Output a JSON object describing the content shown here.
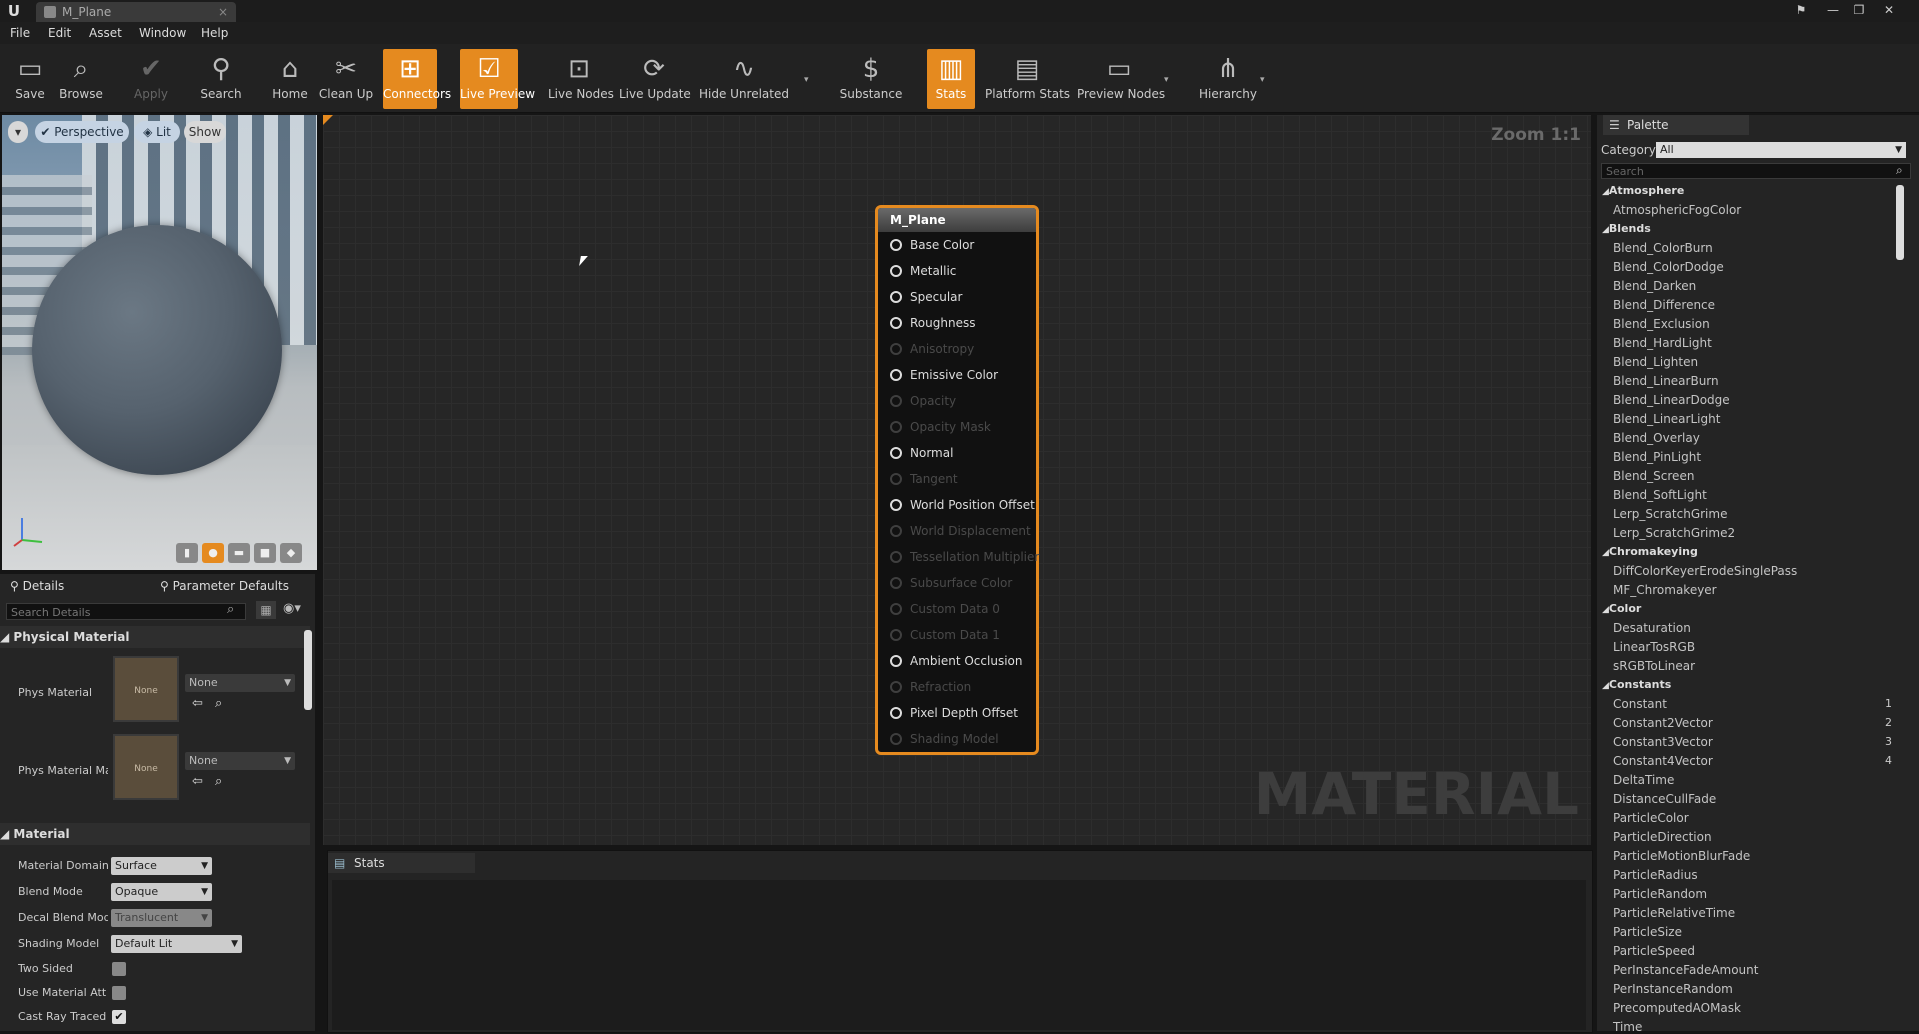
{
  "titlebar": {
    "tab_title": "M_Plane",
    "logo": "U"
  },
  "menu": [
    "File",
    "Edit",
    "Asset",
    "Window",
    "Help"
  ],
  "toolbar": [
    {
      "label": "Save",
      "icon": "save-icon",
      "glyph": "▭",
      "state": "normal"
    },
    {
      "label": "Browse",
      "icon": "browse-icon",
      "glyph": "⌕",
      "state": "normal"
    },
    {
      "label": "Apply",
      "icon": "apply-icon",
      "glyph": "✔",
      "state": "disabled"
    },
    {
      "label": "Search",
      "icon": "search-icon",
      "glyph": "⚲",
      "state": "normal"
    },
    {
      "label": "Home",
      "icon": "home-icon",
      "glyph": "⌂",
      "state": "normal"
    },
    {
      "label": "Clean Up",
      "icon": "cleanup-icon",
      "glyph": "✂",
      "state": "normal"
    },
    {
      "label": "Connectors",
      "icon": "connectors-icon",
      "glyph": "⊞",
      "state": "active"
    },
    {
      "label": "Live Preview",
      "icon": "live-preview-icon",
      "glyph": "☑",
      "state": "active"
    },
    {
      "label": "Live Nodes",
      "icon": "live-nodes-icon",
      "glyph": "⊡",
      "state": "normal"
    },
    {
      "label": "Live Update",
      "icon": "live-update-icon",
      "glyph": "⟳",
      "state": "normal"
    },
    {
      "label": "Hide Unrelated",
      "icon": "hide-unrelated-icon",
      "glyph": "∿",
      "state": "normal"
    },
    {
      "label": "Substance",
      "icon": "substance-icon",
      "glyph": "$",
      "state": "normal"
    },
    {
      "label": "Stats",
      "icon": "stats-icon",
      "glyph": "▥",
      "state": "active"
    },
    {
      "label": "Platform Stats",
      "icon": "platform-stats-icon",
      "glyph": "▤",
      "state": "normal"
    },
    {
      "label": "Preview Nodes",
      "icon": "preview-nodes-icon",
      "glyph": "▭",
      "state": "normal"
    },
    {
      "label": "Hierarchy",
      "icon": "hierarchy-icon",
      "glyph": "⋔",
      "state": "normal"
    }
  ],
  "viewport": {
    "perspective": "Perspective",
    "lit": "Lit",
    "show": "Show"
  },
  "details": {
    "tab_details": "Details",
    "tab_params": "Parameter Defaults",
    "search_placeholder": "Search Details",
    "physical_section": "Physical Material",
    "phys_material_label": "Phys Material",
    "phys_material_thumb": "None",
    "phys_material_value": "None",
    "phys_mask_label": "Phys Material Ma",
    "phys_mask_thumb": "None",
    "phys_mask_value": "None",
    "material_section": "Material",
    "domain_label": "Material Domain",
    "domain_value": "Surface",
    "blend_label": "Blend Mode",
    "blend_value": "Opaque",
    "decal_label": "Decal Blend Mode",
    "decal_value": "Translucent",
    "shading_label": "Shading Model",
    "shading_value": "Default Lit",
    "two_sided_label": "Two Sided",
    "use_material_label": "Use Material Attri",
    "cast_ray_label": "Cast Ray Traced S"
  },
  "graph": {
    "zoom": "Zoom 1:1",
    "watermark": "MATERIAL"
  },
  "node": {
    "title": "M_Plane",
    "pins": [
      {
        "label": "Base Color",
        "enabled": true
      },
      {
        "label": "Metallic",
        "enabled": true
      },
      {
        "label": "Specular",
        "enabled": true
      },
      {
        "label": "Roughness",
        "enabled": true
      },
      {
        "label": "Anisotropy",
        "enabled": false
      },
      {
        "label": "Emissive Color",
        "enabled": true
      },
      {
        "label": "Opacity",
        "enabled": false
      },
      {
        "label": "Opacity Mask",
        "enabled": false
      },
      {
        "label": "Normal",
        "enabled": true
      },
      {
        "label": "Tangent",
        "enabled": false
      },
      {
        "label": "World Position Offset",
        "enabled": true
      },
      {
        "label": "World Displacement",
        "enabled": false
      },
      {
        "label": "Tessellation Multiplier",
        "enabled": false
      },
      {
        "label": "Subsurface Color",
        "enabled": false
      },
      {
        "label": "Custom Data 0",
        "enabled": false
      },
      {
        "label": "Custom Data 1",
        "enabled": false
      },
      {
        "label": "Ambient Occlusion",
        "enabled": true
      },
      {
        "label": "Refraction",
        "enabled": false
      },
      {
        "label": "Pixel Depth Offset",
        "enabled": true
      },
      {
        "label": "Shading Model",
        "enabled": false
      }
    ]
  },
  "stats": {
    "tab": "Stats"
  },
  "palette": {
    "tab": "Palette",
    "category_label": "Category:",
    "category_value": "All",
    "search_placeholder": "Search",
    "rows": [
      {
        "type": "cat",
        "text": "Atmosphere"
      },
      {
        "type": "item",
        "text": "AtmosphericFogColor"
      },
      {
        "type": "cat",
        "text": "Blends"
      },
      {
        "type": "item",
        "text": "Blend_ColorBurn"
      },
      {
        "type": "item",
        "text": "Blend_ColorDodge"
      },
      {
        "type": "item",
        "text": "Blend_Darken"
      },
      {
        "type": "item",
        "text": "Blend_Difference"
      },
      {
        "type": "item",
        "text": "Blend_Exclusion"
      },
      {
        "type": "item",
        "text": "Blend_HardLight"
      },
      {
        "type": "item",
        "text": "Blend_Lighten"
      },
      {
        "type": "item",
        "text": "Blend_LinearBurn"
      },
      {
        "type": "item",
        "text": "Blend_LinearDodge"
      },
      {
        "type": "item",
        "text": "Blend_LinearLight"
      },
      {
        "type": "item",
        "text": "Blend_Overlay"
      },
      {
        "type": "item",
        "text": "Blend_PinLight"
      },
      {
        "type": "item",
        "text": "Blend_Screen"
      },
      {
        "type": "item",
        "text": "Blend_SoftLight"
      },
      {
        "type": "item",
        "text": "Lerp_ScratchGrime"
      },
      {
        "type": "item",
        "text": "Lerp_ScratchGrime2"
      },
      {
        "type": "cat",
        "text": "Chromakeying"
      },
      {
        "type": "item",
        "text": "DiffColorKeyerErodeSinglePass"
      },
      {
        "type": "item",
        "text": "MF_Chromakeyer"
      },
      {
        "type": "cat",
        "text": "Color"
      },
      {
        "type": "item",
        "text": "Desaturation"
      },
      {
        "type": "item",
        "text": "LinearTosRGB"
      },
      {
        "type": "item",
        "text": "sRGBToLinear"
      },
      {
        "type": "cat",
        "text": "Constants"
      },
      {
        "type": "item",
        "text": "Constant",
        "key": "1"
      },
      {
        "type": "item",
        "text": "Constant2Vector",
        "key": "2"
      },
      {
        "type": "item",
        "text": "Constant3Vector",
        "key": "3"
      },
      {
        "type": "item",
        "text": "Constant4Vector",
        "key": "4"
      },
      {
        "type": "item",
        "text": "DeltaTime"
      },
      {
        "type": "item",
        "text": "DistanceCullFade"
      },
      {
        "type": "item",
        "text": "ParticleColor"
      },
      {
        "type": "item",
        "text": "ParticleDirection"
      },
      {
        "type": "item",
        "text": "ParticleMotionBlurFade"
      },
      {
        "type": "item",
        "text": "ParticleRadius"
      },
      {
        "type": "item",
        "text": "ParticleRandom"
      },
      {
        "type": "item",
        "text": "ParticleRelativeTime"
      },
      {
        "type": "item",
        "text": "ParticleSize"
      },
      {
        "type": "item",
        "text": "ParticleSpeed"
      },
      {
        "type": "item",
        "text": "PerInstanceFadeAmount"
      },
      {
        "type": "item",
        "text": "PerInstanceRandom"
      },
      {
        "type": "item",
        "text": "PrecomputedAOMask"
      },
      {
        "type": "item",
        "text": "Time"
      }
    ]
  },
  "colors": {
    "accent": "#e58a1f",
    "background": "#151515",
    "graph": "#262626"
  }
}
